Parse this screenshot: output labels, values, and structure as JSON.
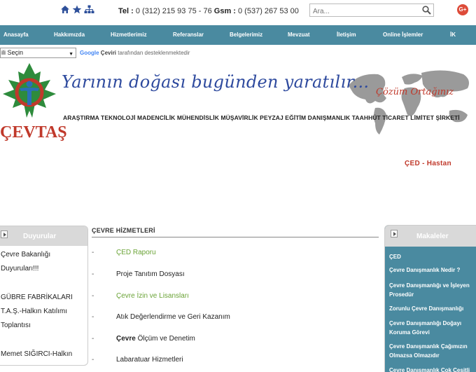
{
  "topbar": {
    "phone_label": "Tel :",
    "phone_number": " 0 (312) 215 93 75 - 76 ",
    "gsm_label": "Gsm :",
    "gsm_number": " 0 (537) 267 53 00",
    "search_placeholder": "Ara..."
  },
  "nav": [
    "Anasayfa",
    "Hakkımızda",
    "Hizmetlerimiz",
    "Referanslar",
    "Belgelerimiz",
    "Mevzuat",
    "İletişim",
    "Online İşlemler",
    "İK"
  ],
  "translate": {
    "select_value": "ili Seçin",
    "google": "Google",
    "ceviri": "Çeviri",
    "provided": "tarafından desteklenmektedir"
  },
  "banner": {
    "logo_text": "ÇEVTAŞ",
    "slogan": "Yarının doğası bugünden yaratılır...",
    "slogan2": "Çözüm Ortağınız",
    "company": "ARAŞTIRMA TEKNOLOJİ MADENCİLİK MÜHENDİSLİK MÜŞAVİRLİK PEYZAJ EĞİTİM DANIŞMANLIK TAAHHÜT TİCARET LİMİTET ŞİRKETİ",
    "ticker": "ÇED - Hastan"
  },
  "left_panel": {
    "title": "Duyurular",
    "items": [
      "Çevre Bakanlığı",
      "Duyuruları!!!",
      "GÜBRE FABRİKALARI",
      "T.A.Ş.-Halkın Katılımı",
      "Toplantısı",
      "Memet SIĞIRCI-Halkın"
    ]
  },
  "center": {
    "title": "ÇEVRE HİZMETLERİ",
    "dash": "-",
    "services": [
      "ÇED Raporu",
      "Proje Tanıtım Dosyası",
      "Çevre İzin ve Lisansları",
      "Atık Değerlendirme ve Geri Kazanım",
      "Çevre Ölçüm ve Denetim",
      "Labaratuar Hizmetleri"
    ],
    "bold_word": "Çevre",
    "rest_word": " Ölçüm ve Denetim"
  },
  "right_panel": {
    "title": "Makaleler",
    "links": [
      "ÇED",
      "Çevre Danışmanlık Nedir ?",
      "Çevre Danışmanlığı ve İşleyen Prosedür",
      "Zorunlu Çevre Danışmanlığı",
      "Çevre Danışmanlığı Doğayı Koruma Görevi",
      "Çevre Danışmanlık Çağımızın Olmazsa Olmazıdır",
      "Çevre Danışmanlık Çok Çeşitli"
    ]
  },
  "colors": {
    "nav_bg": "#4a8aa0",
    "link_green": "#6aa336",
    "brand_red": "#c0392b",
    "slogan_blue": "#2e4a9e"
  },
  "icons": [
    "home-icon",
    "star-icon",
    "sitemap-icon",
    "search-icon",
    "google-plus-icon",
    "dropdown-arrow-icon",
    "panel-arrow-icon"
  ]
}
